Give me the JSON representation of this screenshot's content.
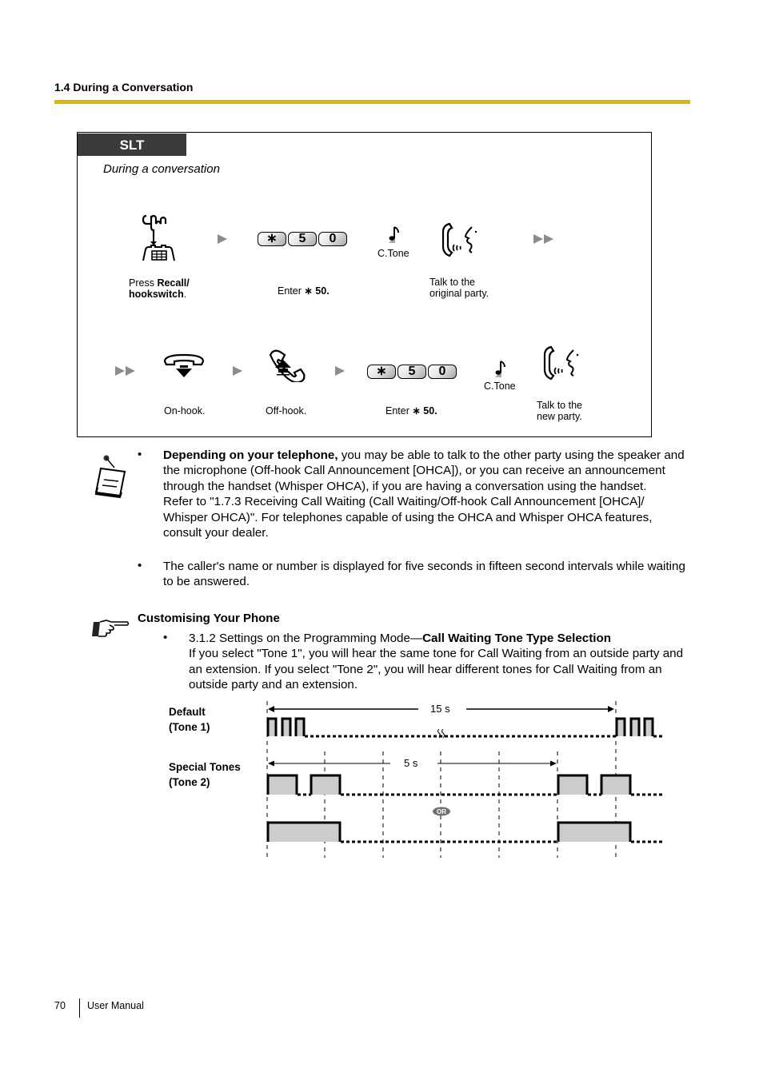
{
  "header": {
    "section_title": "1.4 During a Conversation",
    "accent_color": "#dcb900"
  },
  "slt_box": {
    "tab_label": "SLT",
    "subtitle": "During a conversation",
    "row1": {
      "step1": {
        "icon": "recall-hookswitch-icon",
        "caption_prefix": "Press ",
        "caption_bold": "Recall/ hookswitch",
        "caption_suffix": "."
      },
      "step2": {
        "keys": [
          "∗",
          "5",
          "0"
        ],
        "caption_prefix": "Enter ",
        "caption_bold": "∗ 50."
      },
      "tone_label": "C.Tone",
      "step3": {
        "icon": "talk-handset-icon",
        "caption": "Talk to the original party."
      }
    },
    "row2": {
      "step1": {
        "icon": "on-hook-icon",
        "caption": "On-hook."
      },
      "step2": {
        "icon": "off-hook-icon",
        "caption": "Off-hook."
      },
      "step3": {
        "keys": [
          "∗",
          "5",
          "0"
        ],
        "caption_prefix": "Enter ",
        "caption_bold": "∗ 50."
      },
      "tone_label": "C.Tone",
      "step4": {
        "icon": "talk-handset-icon",
        "caption": "Talk to the new party."
      }
    }
  },
  "notes": {
    "icon": "notepad-icon",
    "items": [
      {
        "bold": "Depending on your telephone,",
        "text": " you may be able to talk to the other party using the speaker and the microphone (Off-hook Call Announcement [OHCA]), or you can receive an announcement through the handset (Whisper OHCA), if you are having a conversation using the handset.",
        "text2": "Refer to \"1.7.3 Receiving Call Waiting (Call Waiting/Off-hook Call Announcement [OHCA]/ Whisper OHCA)\". For telephones capable of using the OHCA and Whisper OHCA features, consult your dealer."
      },
      {
        "text": "The caller's name or number is displayed for five seconds in fifteen second intervals while waiting to be answered."
      }
    ]
  },
  "customising": {
    "icon": "pointing-hand-icon",
    "heading": "Customising Your Phone",
    "item_prefix": "3.1.2 Settings on the Programming Mode—",
    "item_bold": "Call Waiting Tone Type Selection",
    "item_text": "If you select \"Tone 1\", you will hear the same tone for Call Waiting from an outside party and an extension. If you select \"Tone 2\", you will hear different tones for Call Waiting from an outside party and an extension."
  },
  "tone_diagram": {
    "default_label_1": "Default",
    "default_label_2": "(Tone 1)",
    "special_label_1": "Special Tones",
    "special_label_2": "(Tone 2)",
    "interval_15": "15 s",
    "interval_5": "5 s",
    "or_label": "OR",
    "fill_color": "#cccccc"
  },
  "footer": {
    "page_number": "70",
    "doc_title": "User Manual"
  }
}
